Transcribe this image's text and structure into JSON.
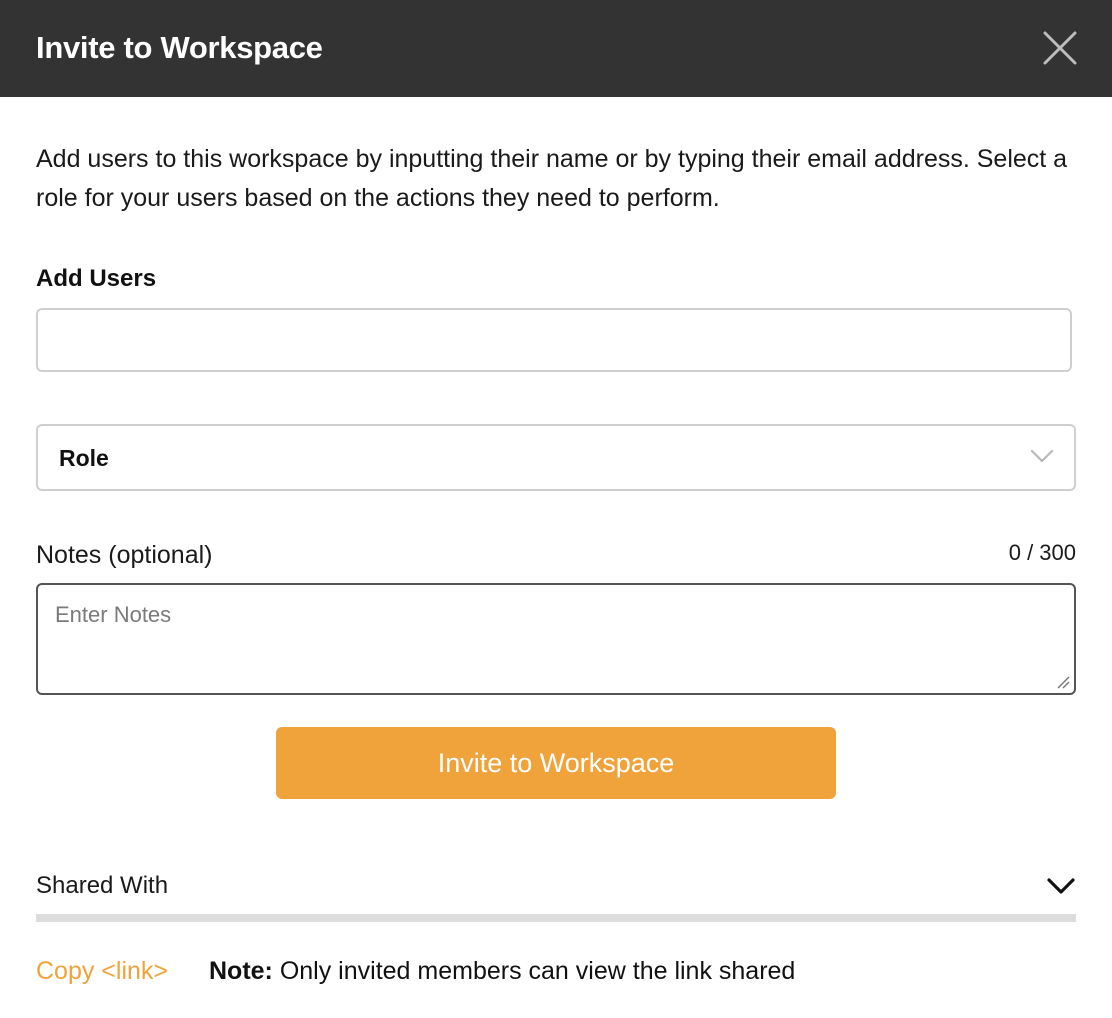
{
  "header": {
    "title": "Invite to Workspace",
    "close_icon": "close-icon"
  },
  "description": "Add users to this workspace by inputting their name or by typing their email address. Select a role for your users based on the actions they need to perform.",
  "add_users": {
    "label": "Add Users",
    "value": ""
  },
  "role": {
    "selected": "Role",
    "chevron_icon": "chevron-down-icon"
  },
  "notes": {
    "label": "Notes (optional)",
    "counter": "0 / 300",
    "placeholder": "Enter Notes",
    "value": ""
  },
  "invite_button": {
    "label": "Invite to Workspace"
  },
  "shared_with": {
    "label": "Shared With",
    "chevron_icon": "chevron-down-icon"
  },
  "footer": {
    "copy_link": "Copy <link>",
    "note_prefix": "Note:",
    "note_text": " Only invited members can view the link shared"
  },
  "colors": {
    "header_bg": "#333333",
    "accent": "#f0a33a",
    "divider": "#dddddd"
  }
}
